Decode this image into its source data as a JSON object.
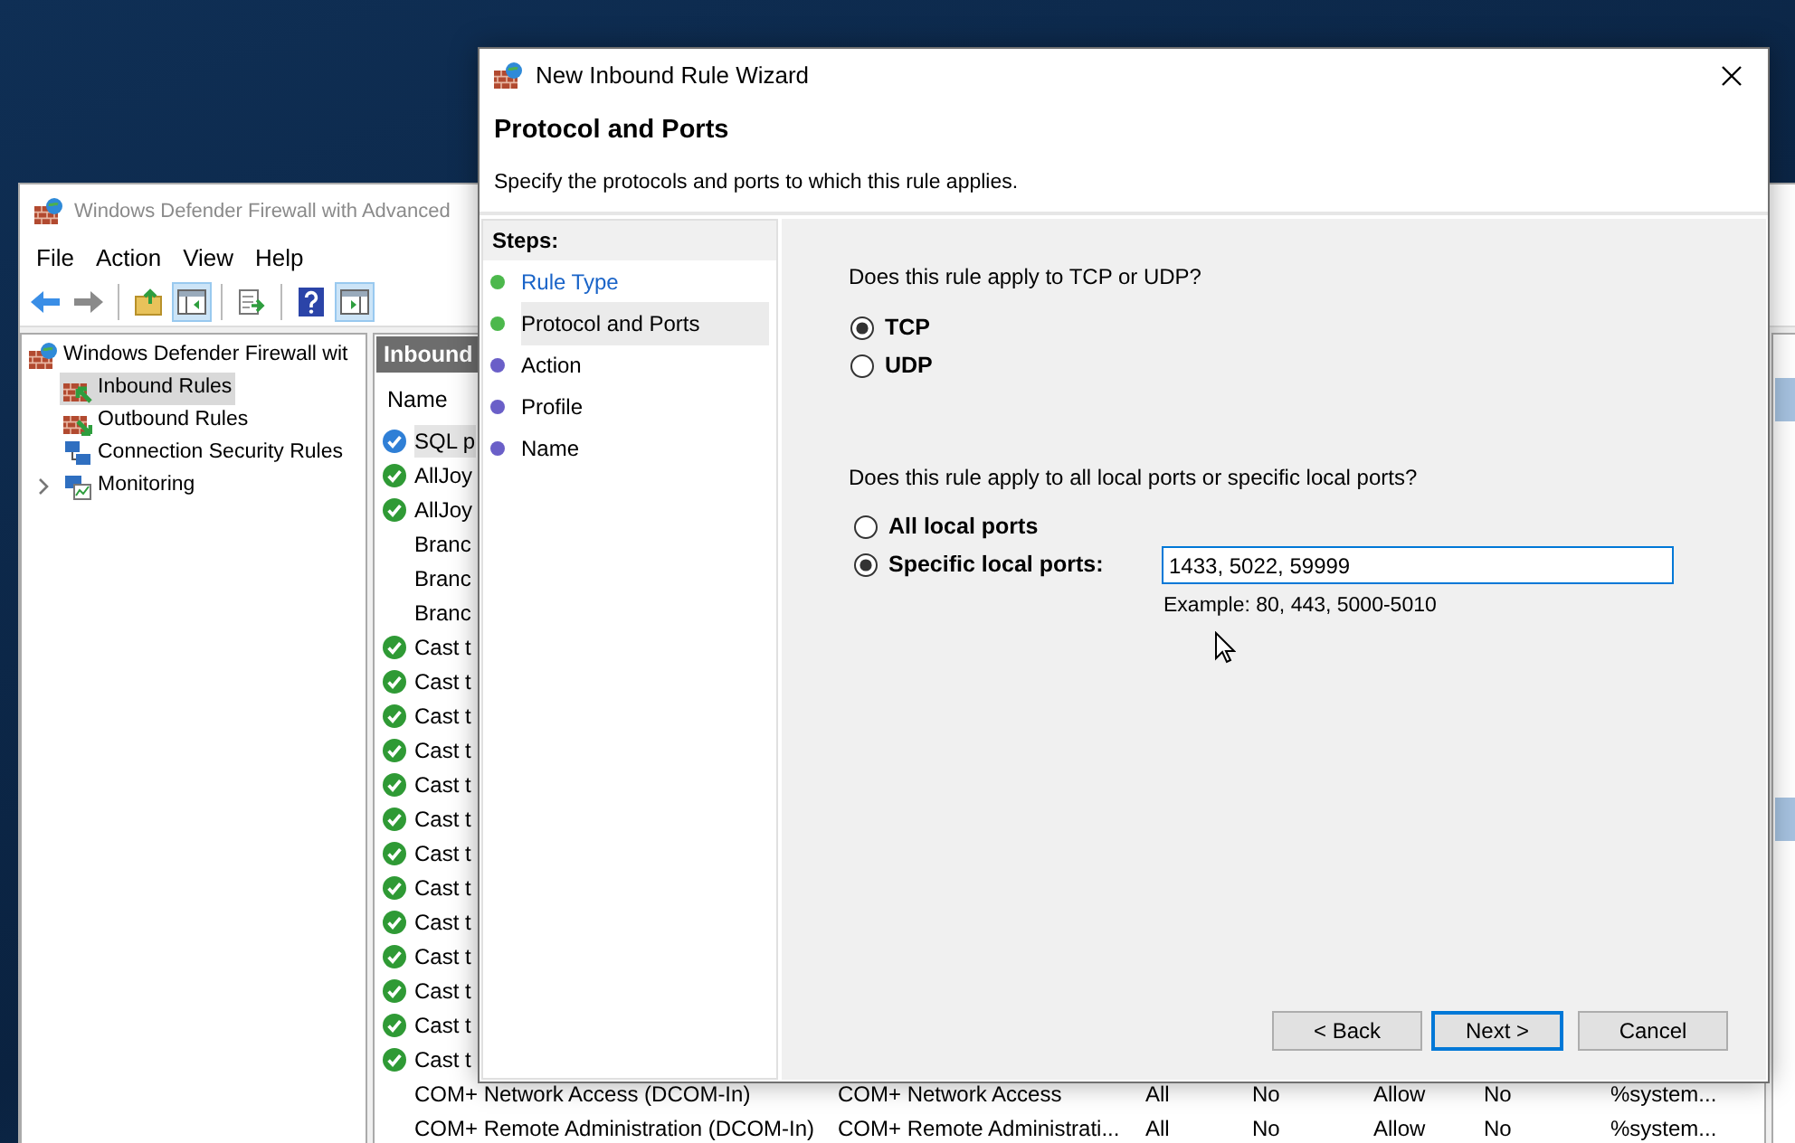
{
  "console": {
    "title": "Windows Defender Firewall with Advanced",
    "menu": [
      "File",
      "Action",
      "View",
      "Help"
    ],
    "toolbar": [
      {
        "kind": "back",
        "pressed": false
      },
      {
        "kind": "forward",
        "pressed": false
      },
      {
        "kind": "separator"
      },
      {
        "kind": "up",
        "pressed": false
      },
      {
        "kind": "console-tree",
        "pressed": true
      },
      {
        "kind": "separator"
      },
      {
        "kind": "export",
        "pressed": false
      },
      {
        "kind": "separator"
      },
      {
        "kind": "help",
        "pressed": false
      },
      {
        "kind": "action-pane",
        "pressed": true
      }
    ],
    "tree": [
      {
        "label": "Windows Defender Firewall wit",
        "kind": "firewall",
        "selected": false,
        "children": [
          {
            "label": "Inbound Rules",
            "kind": "inbound",
            "selected": true
          },
          {
            "label": "Outbound Rules",
            "kind": "outbound",
            "selected": false
          },
          {
            "label": "Connection Security Rules",
            "kind": "connection",
            "selected": false
          },
          {
            "label": "Monitoring",
            "kind": "monitoring",
            "selected": false,
            "expanded": false
          }
        ]
      }
    ],
    "rules_pane": {
      "title": "Inbound",
      "column_1": "Name",
      "rows": [
        {
          "cells": [
            "SQL p"
          ],
          "kind": "custom",
          "selected": true
        },
        {
          "cells": [
            "AllJoy"
          ],
          "kind": "enabled",
          "selected": false
        },
        {
          "cells": [
            "AllJoy"
          ],
          "kind": "enabled",
          "selected": false
        },
        {
          "cells": [
            "Branc"
          ],
          "kind": "disabled",
          "selected": false
        },
        {
          "cells": [
            "Branc"
          ],
          "kind": "disabled",
          "selected": false
        },
        {
          "cells": [
            "Branc"
          ],
          "kind": "disabled",
          "selected": false
        },
        {
          "cells": [
            "Cast t"
          ],
          "kind": "enabled",
          "selected": false
        },
        {
          "cells": [
            "Cast t"
          ],
          "kind": "enabled",
          "selected": false
        },
        {
          "cells": [
            "Cast t"
          ],
          "kind": "enabled",
          "selected": false
        },
        {
          "cells": [
            "Cast t"
          ],
          "kind": "enabled",
          "selected": false
        },
        {
          "cells": [
            "Cast t"
          ],
          "kind": "enabled",
          "selected": false
        },
        {
          "cells": [
            "Cast t"
          ],
          "kind": "enabled",
          "selected": false
        },
        {
          "cells": [
            "Cast t"
          ],
          "kind": "enabled",
          "selected": false
        },
        {
          "cells": [
            "Cast t"
          ],
          "kind": "enabled",
          "selected": false
        },
        {
          "cells": [
            "Cast t"
          ],
          "kind": "enabled",
          "selected": false
        },
        {
          "cells": [
            "Cast t"
          ],
          "kind": "enabled",
          "selected": false
        },
        {
          "cells": [
            "Cast t"
          ],
          "kind": "enabled",
          "selected": false
        },
        {
          "cells": [
            "Cast t"
          ],
          "kind": "enabled",
          "selected": false
        },
        {
          "cells": [
            "Cast t"
          ],
          "kind": "enabled",
          "selected": false
        },
        {
          "cells": [
            "COM+ Network Access (DCOM-In)",
            "COM+ Network Access",
            "All",
            "No",
            "Allow",
            "No",
            "%system..."
          ],
          "kind": "disabled",
          "selected": false
        },
        {
          "cells": [
            "COM+ Remote Administration (DCOM-In)",
            "COM+ Remote Administrati...",
            "All",
            "No",
            "Allow",
            "No",
            "%system..."
          ],
          "kind": "disabled",
          "selected": false
        }
      ]
    }
  },
  "wizard": {
    "title": "New Inbound Rule Wizard",
    "heading": "Protocol and Ports",
    "subtitle": "Specify the protocols and ports to which this rule applies.",
    "steps_title": "Steps:",
    "steps": [
      {
        "label": "Rule Type",
        "completed": true,
        "selected": false
      },
      {
        "label": "Protocol and Ports",
        "completed": true,
        "selected": true
      },
      {
        "label": "Action",
        "completed": false,
        "selected": false
      },
      {
        "label": "Profile",
        "completed": false,
        "selected": false
      },
      {
        "label": "Name",
        "completed": false,
        "selected": false
      }
    ],
    "protocol": {
      "question": "Does this rule apply to TCP or UDP?",
      "options": [
        {
          "label": "TCP",
          "selected": true
        },
        {
          "label": "UDP",
          "selected": false
        }
      ]
    },
    "ports": {
      "question": "Does this rule apply to all local ports or specific local ports?",
      "options": [
        {
          "label": "All local ports",
          "selected": false
        },
        {
          "label": "Specific local ports:",
          "selected": true
        }
      ],
      "value": "1433, 5022, 59999",
      "example": "Example: 80, 443, 5000-5010"
    },
    "buttons": [
      {
        "label": "< Back",
        "default": false
      },
      {
        "label": "Next >",
        "default": true
      },
      {
        "label": "Cancel",
        "default": false
      }
    ]
  }
}
